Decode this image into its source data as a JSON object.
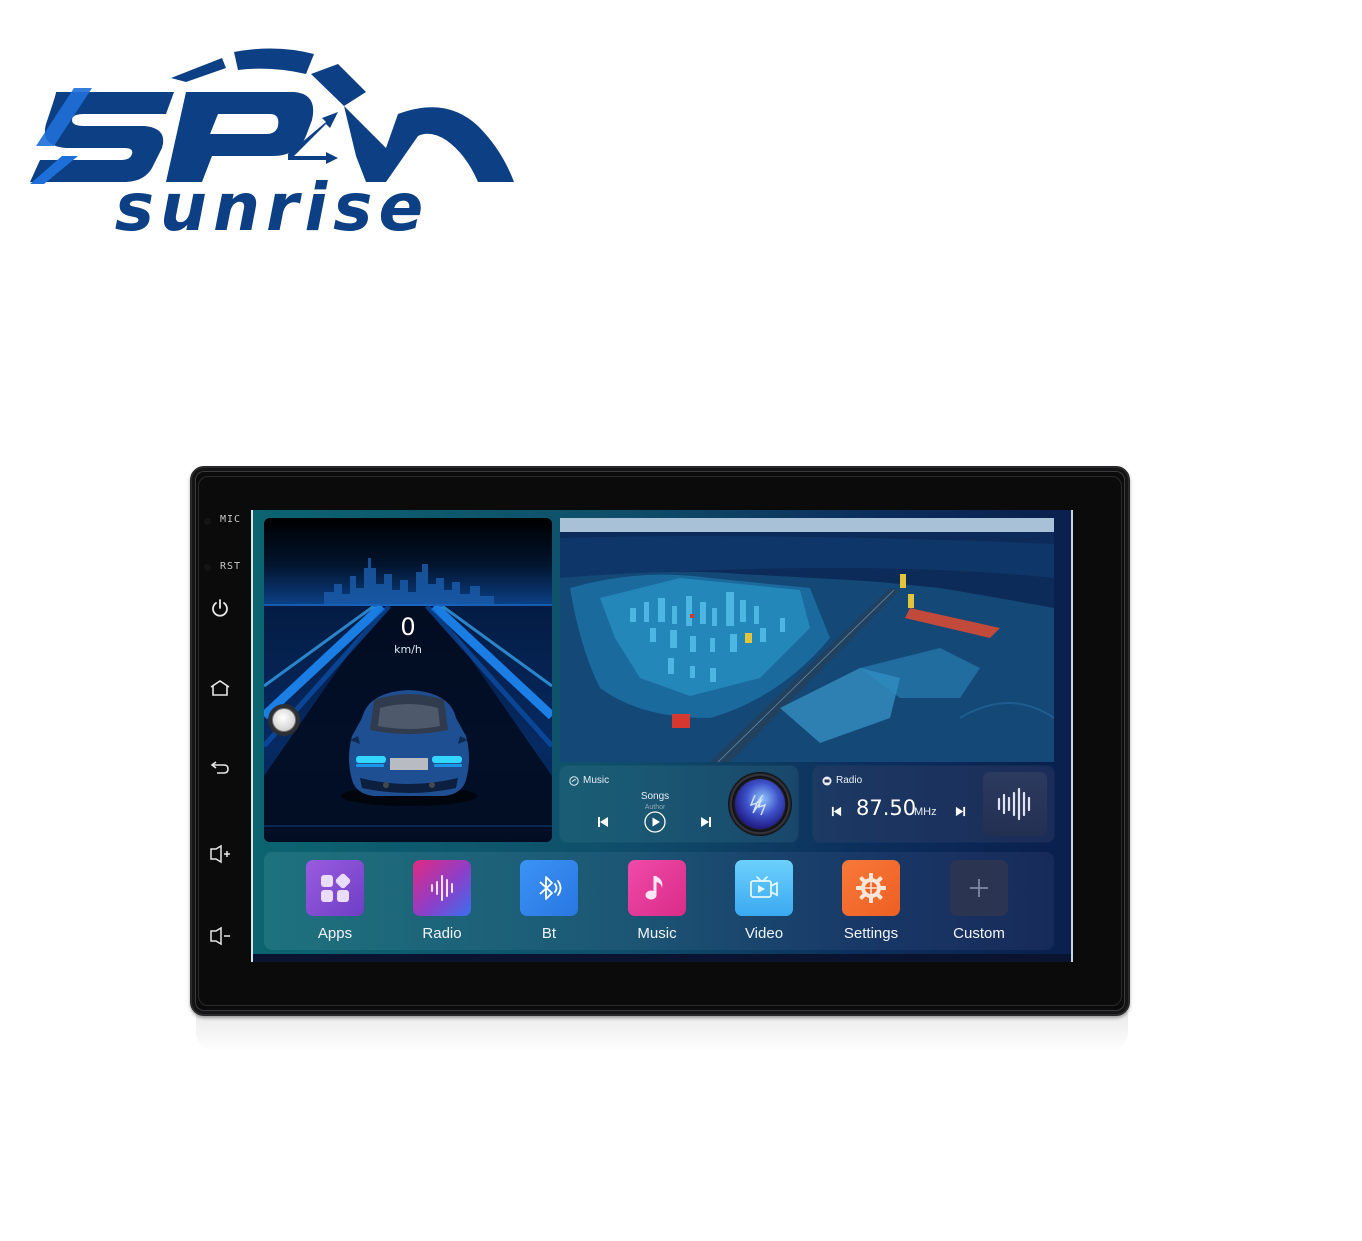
{
  "brand": {
    "logo_top": "SPM",
    "logo_bottom": "sunrise",
    "color_primary": "#0d3f84",
    "color_accent": "#1f6fd8"
  },
  "device": {
    "side_labels": [
      "MIC",
      "RST"
    ],
    "side_buttons": [
      {
        "name": "power",
        "icon": "power-icon"
      },
      {
        "name": "home",
        "icon": "home-icon"
      },
      {
        "name": "back",
        "icon": "back-icon"
      },
      {
        "name": "volume-up",
        "icon": "volume-up-icon",
        "label": "+"
      },
      {
        "name": "volume-down",
        "icon": "volume-down-icon",
        "label": "-"
      }
    ]
  },
  "speed_widget": {
    "value": "0",
    "unit": "km/h"
  },
  "music_widget": {
    "title": "Music",
    "song": "Songs",
    "author": "Author",
    "controls": [
      "previous",
      "play",
      "next"
    ]
  },
  "radio_widget": {
    "title": "Radio",
    "frequency": "87.50",
    "unit": "MHz",
    "controls": [
      "previous",
      "next"
    ]
  },
  "dock": {
    "items": [
      {
        "label": "Apps",
        "icon": "apps-icon",
        "color": "#8b4fd6"
      },
      {
        "label": "Radio",
        "icon": "radio-wave-icon",
        "color": "#c2338f"
      },
      {
        "label": "Bt",
        "icon": "bluetooth-icon",
        "color": "#2f86ee"
      },
      {
        "label": "Music",
        "icon": "music-note-icon",
        "color": "#e2389a"
      },
      {
        "label": "Video",
        "icon": "video-camera-icon",
        "color": "#4ab8f2"
      },
      {
        "label": "Settings",
        "icon": "gear-icon",
        "color": "#f2692a"
      },
      {
        "label": "Custom",
        "icon": "plus-icon",
        "color": "#2b3450"
      }
    ]
  }
}
